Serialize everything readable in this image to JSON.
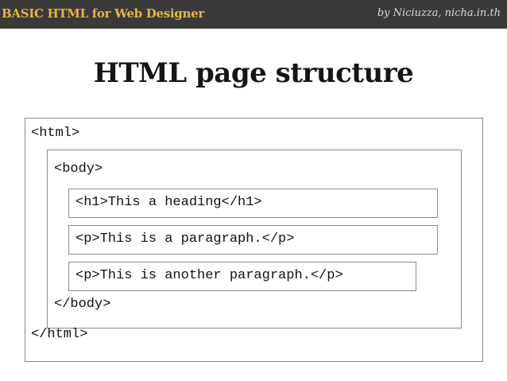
{
  "header": {
    "brand": "BASIC HTML for Web Designer",
    "byline": "by Niciuzza, nicha.in.th"
  },
  "slide": {
    "title": "HTML page structure"
  },
  "code": {
    "html_open": "<html>",
    "body_open": "<body>",
    "h1_line": "<h1>This a heading</h1>",
    "p1_line": "<p>This is a paragraph.</p>",
    "p2_line": "<p>This is another paragraph.</p>",
    "body_close": "</body>",
    "html_close": "</html>"
  },
  "colors": {
    "topbar": "#3a3a3a",
    "brand": "#e8b33c",
    "byline": "#d9d9d9",
    "border": "#8c8c8c"
  }
}
